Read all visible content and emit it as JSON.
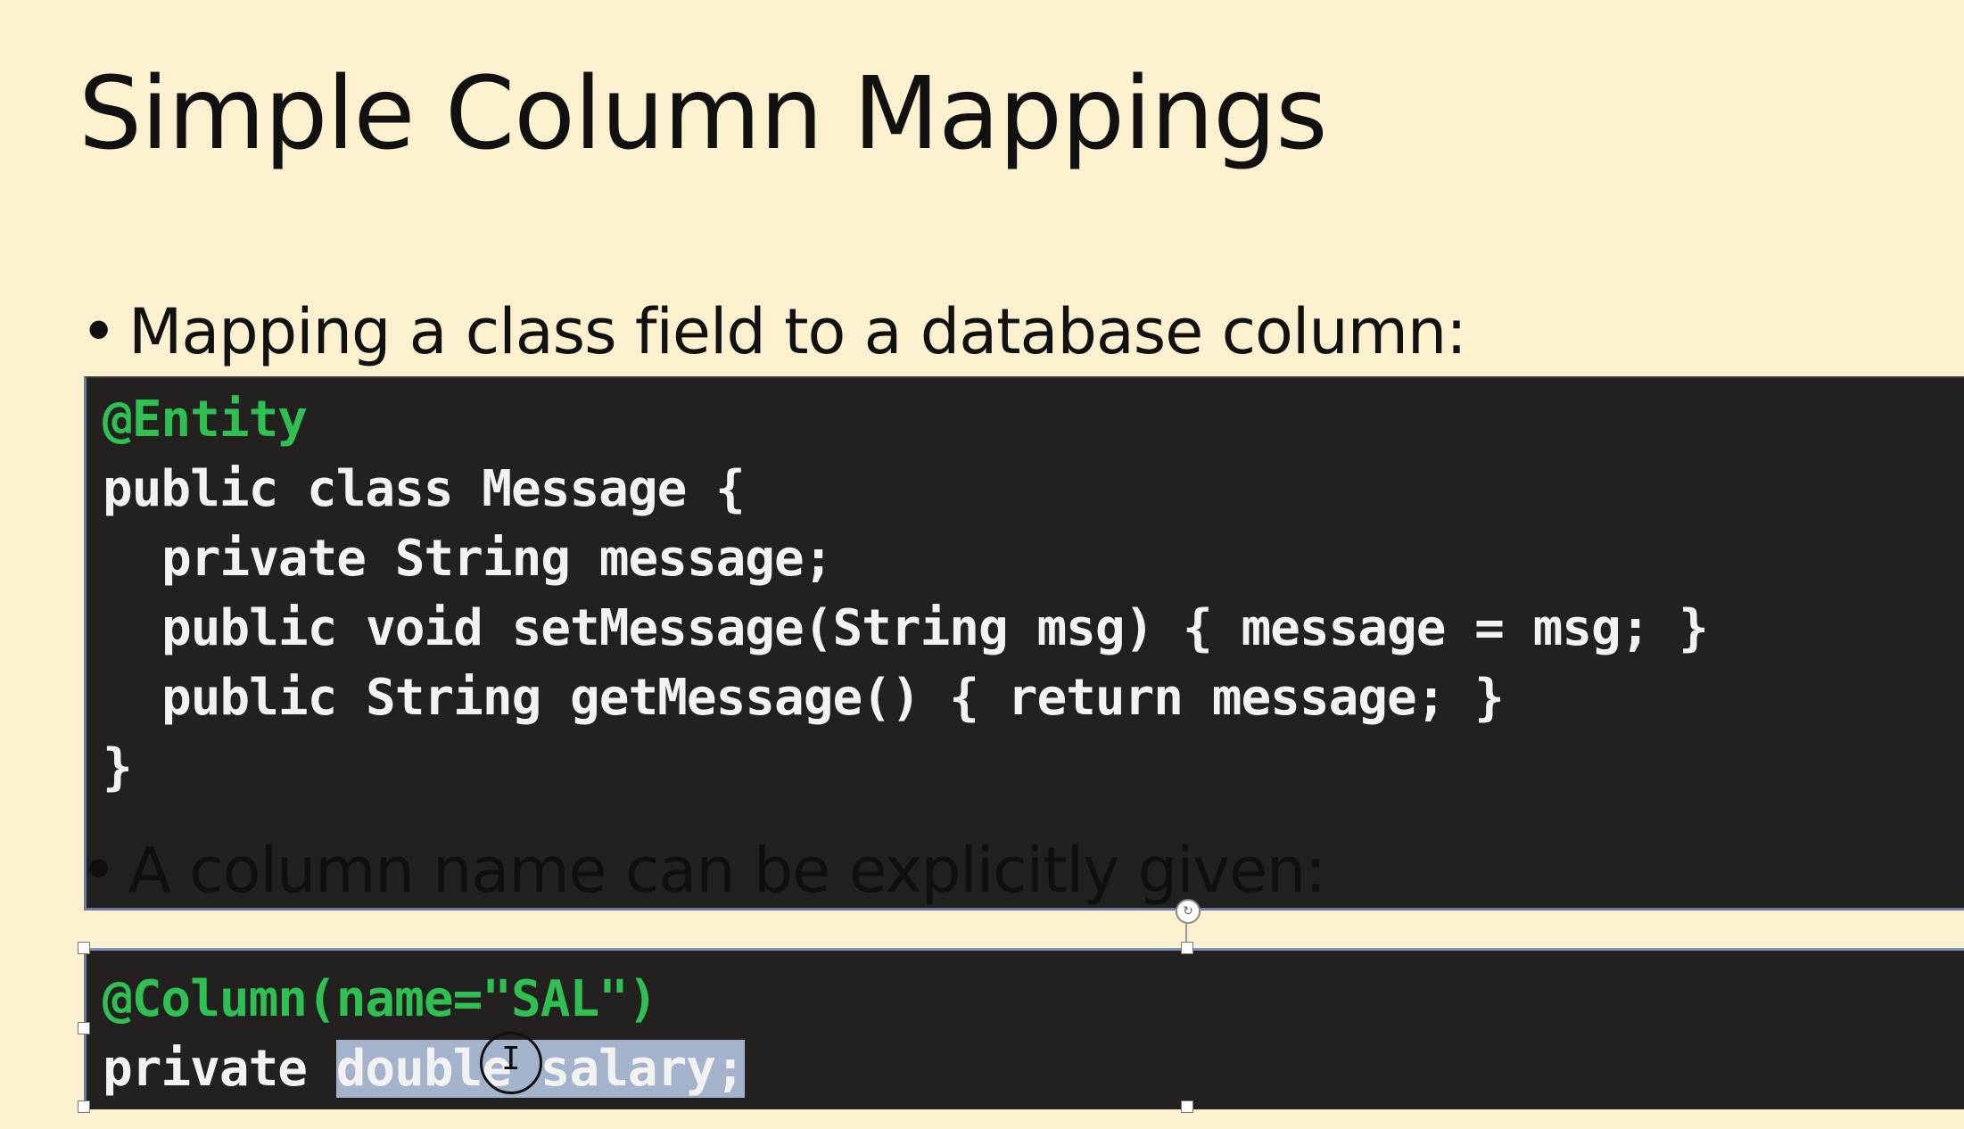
{
  "slide": {
    "title": "Simple Column Mappings",
    "bullets": [
      {
        "bullet_char": "•",
        "text": "Mapping a class field to a database column:"
      },
      {
        "bullet_char": "•",
        "text": "A column name can be explicitly given:"
      }
    ],
    "code_block_1": {
      "annotation": "@Entity",
      "lines": [
        "public class Message {",
        "private String message;",
        "public void setMessage(String msg) { message = msg; }",
        "public String getMessage() { return message; }",
        "}"
      ]
    },
    "code_block_2": {
      "annotation": "@Column(name=\"SAL\")",
      "line_prefix": "private ",
      "selected_text": "double salary;"
    }
  },
  "selection": {
    "rotate_handle_icon": "rotate-icon",
    "cursor_icon": "text-cursor-icon",
    "rotate_glyph": "↻",
    "cursor_glyph": "I"
  },
  "colors": {
    "background": "#fcf1cf",
    "code_background": "#23211f",
    "annotation": "#2fbf52",
    "code_text": "#f2f2f2",
    "selection_highlight": "#a3b3cc"
  }
}
